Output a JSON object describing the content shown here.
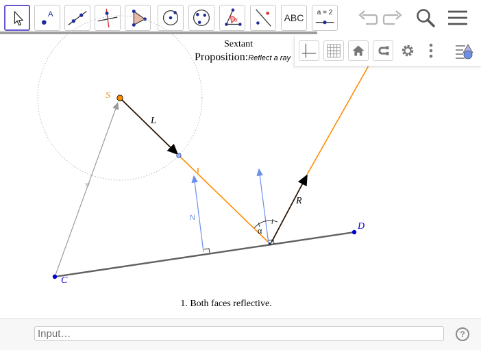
{
  "toolbar": {
    "tools": [
      {
        "id": "move",
        "icon": "move-arrow-icon"
      },
      {
        "id": "point",
        "icon": "point-icon",
        "label": "A"
      },
      {
        "id": "line",
        "icon": "line-through-points-icon"
      },
      {
        "id": "perpendicular",
        "icon": "perpendicular-line-icon"
      },
      {
        "id": "polygon",
        "icon": "polygon-icon"
      },
      {
        "id": "circle",
        "icon": "circle-center-point-icon"
      },
      {
        "id": "conic",
        "icon": "circle-three-points-icon"
      },
      {
        "id": "angle",
        "icon": "angle-icon",
        "label": "α"
      },
      {
        "id": "reflect",
        "icon": "reflect-about-line-icon"
      },
      {
        "id": "text",
        "icon": "text-icon",
        "label": "ABC"
      },
      {
        "id": "slider",
        "icon": "slider-icon",
        "label": "a = 2"
      }
    ],
    "selected_tool": "move",
    "actions": [
      "undo-icon",
      "redo-icon",
      "search-icon",
      "menu-icon"
    ]
  },
  "style_bar": {
    "buttons": [
      "axes-icon",
      "grid-icon",
      "home-icon",
      "point-capture-icon",
      "settings-icon",
      "more-vertical-icon",
      "toggle-style-bar-icon"
    ]
  },
  "canvas": {
    "title": "Sextant",
    "proposition_label": "Proposition:",
    "proposition_text": "Reflect a ray",
    "caption": "1. Both faces reflective.",
    "point_labels": {
      "S": "S",
      "C": "C",
      "D": "D"
    },
    "segment_labels": {
      "L": "L",
      "R": "R",
      "N": "N",
      "w": "w",
      "alpha": "α"
    },
    "colors": {
      "orange": "#ff8c00",
      "blue_point": "#0000cc",
      "normal_blue": "#6b8fe8",
      "mirror_gray": "#606060",
      "ray_black": "#2b1400",
      "selected_tool": "#6557d2"
    }
  },
  "input_bar": {
    "placeholder": "Input…",
    "help_label": "?"
  }
}
